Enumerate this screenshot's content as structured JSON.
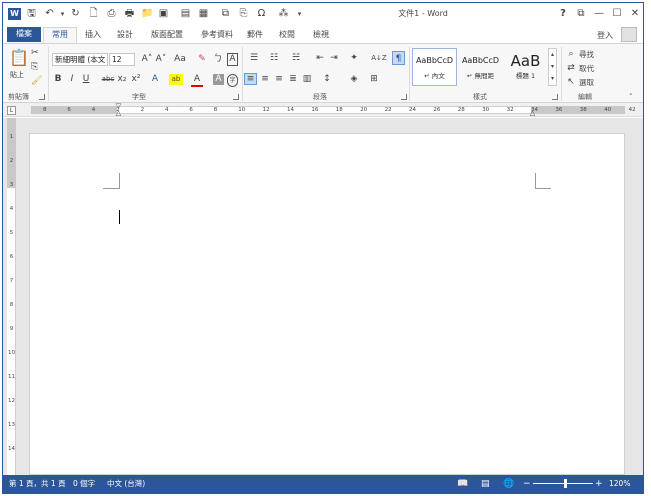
{
  "titlebar": {
    "app_icon": "W",
    "title": "文件1 - Word",
    "qat": [
      "save-icon",
      "undo-icon",
      "redo-icon",
      "new-doc-icon",
      "print-preview-icon",
      "open-folder-icon",
      "insert-picture-icon",
      "table-icon",
      "ribbon-icon",
      "insert-link-icon",
      "symbol-icon",
      "flowchart-icon",
      "customize-icon"
    ],
    "help": "?",
    "ribbon_opts": "⧉",
    "minimize": "—",
    "maximize": "☐",
    "close": "✕"
  },
  "tabs": {
    "file": "檔案",
    "items": [
      "常用",
      "插入",
      "設計",
      "版面配置",
      "參考資料",
      "郵件",
      "校閱",
      "檢視"
    ],
    "active": "常用",
    "signin": "登入"
  },
  "ribbon": {
    "clipboard": {
      "paste": "貼上",
      "label": "剪貼簿"
    },
    "font": {
      "family": "新細明體 (本文",
      "size": "12",
      "grow": "A˄",
      "shrink": "A˅",
      "case": "Aa",
      "clear": "✎",
      "phonetic": "ㄅ",
      "border_char": "A",
      "bold": "B",
      "italic": "I",
      "underline": "U",
      "strike": "abc",
      "subscript": "x₂",
      "superscript": "x²",
      "text_effects": "A",
      "highlight": "ab",
      "font_color": "A",
      "shading": "A",
      "enclose": "字",
      "label": "字型"
    },
    "paragraph": {
      "label": "段落",
      "sort": "A↓Z",
      "marks": "¶"
    },
    "styles": {
      "items": [
        {
          "sample": "AaBbCcD",
          "name": "↵ 內文"
        },
        {
          "sample": "AaBbCcD",
          "name": "↵ 無間距"
        },
        {
          "sample": "AaB",
          "name": "標題 1"
        }
      ],
      "label": "樣式"
    },
    "editing": {
      "find": "尋找",
      "replace": "取代",
      "select": "選取",
      "label": "編輯"
    }
  },
  "ruler": {
    "tab_selector": "L",
    "numbers": [
      "8",
      "6",
      "4",
      "2",
      "2",
      "4",
      "6",
      "8",
      "10",
      "12",
      "14",
      "16",
      "18",
      "20",
      "22",
      "24",
      "26",
      "28",
      "30",
      "32",
      "34",
      "36",
      "38",
      "40",
      "42"
    ]
  },
  "vruler": {
    "numbers": [
      "1",
      "2",
      "3",
      "4",
      "5",
      "6",
      "7",
      "8",
      "9",
      "10",
      "11",
      "12",
      "13",
      "14"
    ]
  },
  "status": {
    "page": "第 1 頁，共 1 頁",
    "words": "0 個字",
    "language": "中文 (台灣)",
    "zoom": "120%",
    "zoom_minus": "−",
    "zoom_plus": "+"
  }
}
